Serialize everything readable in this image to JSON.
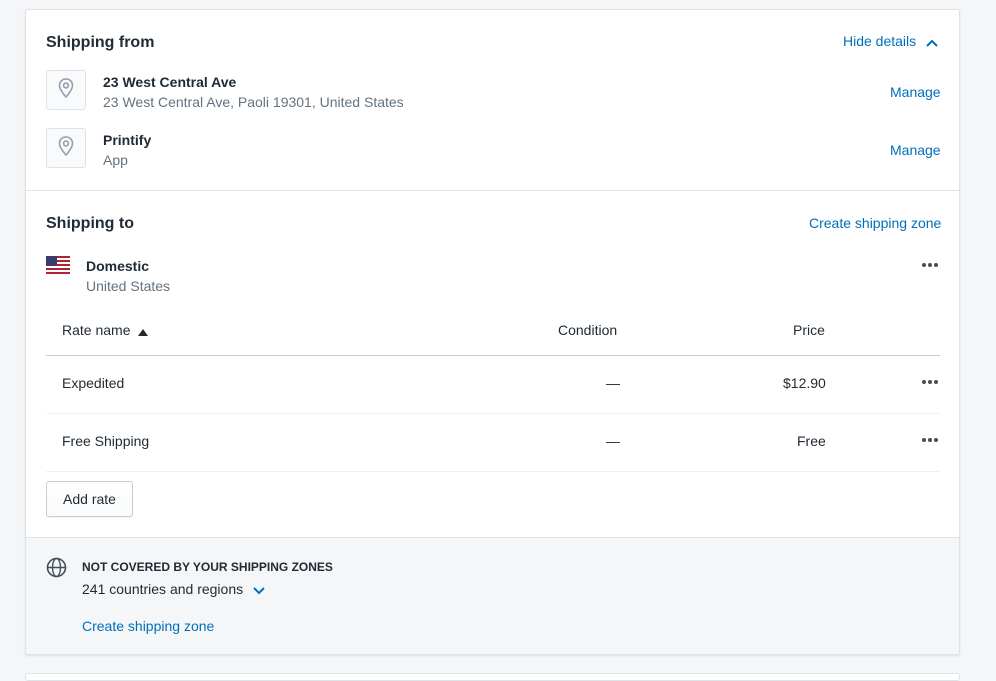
{
  "shipping_from": {
    "title": "Shipping from",
    "hide_details_label": "Hide details",
    "locations": [
      {
        "name": "23 West Central Ave",
        "detail": "23 West Central Ave, Paoli 19301, United States",
        "manage_label": "Manage"
      },
      {
        "name": "Printify",
        "detail": "App",
        "manage_label": "Manage"
      }
    ]
  },
  "shipping_to": {
    "title": "Shipping to",
    "create_zone_label": "Create shipping zone",
    "zone": {
      "name": "Domestic",
      "country": "United States",
      "flag": "us-flag-icon"
    },
    "table": {
      "headers": {
        "rate_name": "Rate name",
        "condition": "Condition",
        "price": "Price"
      },
      "sort": "ascending",
      "rows": [
        {
          "name": "Expedited",
          "condition": "—",
          "price": "$12.90"
        },
        {
          "name": "Free Shipping",
          "condition": "—",
          "price": "Free"
        }
      ]
    },
    "add_rate_label": "Add rate"
  },
  "not_covered": {
    "heading": "NOT COVERED BY YOUR SHIPPING ZONES",
    "count_label": "241 countries and regions",
    "create_zone_label": "Create shipping zone"
  },
  "colors": {
    "link": "#006fbb",
    "text": "#212b36",
    "subdued": "#637381",
    "border": "#dfe3e8",
    "footer_bg": "#f4f6f8"
  }
}
